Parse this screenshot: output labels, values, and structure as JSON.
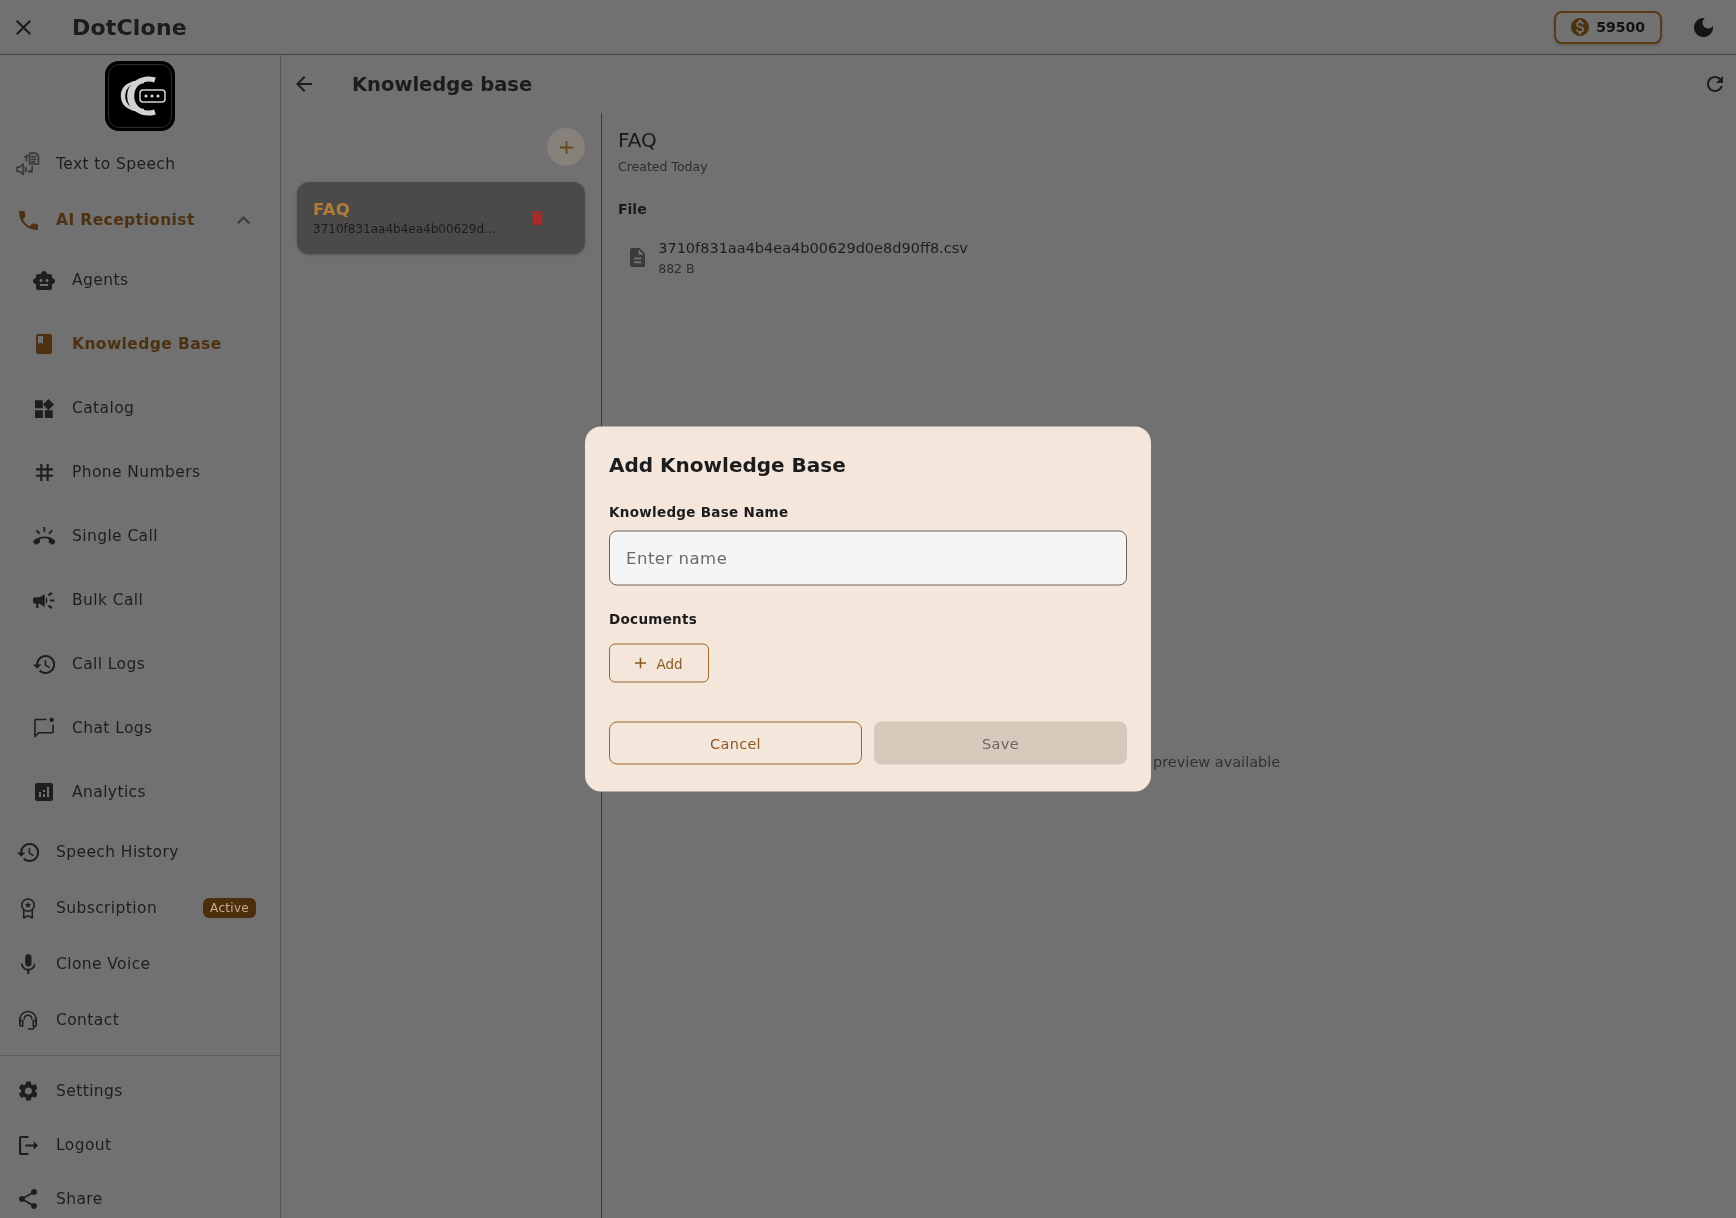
{
  "app_bar": {
    "title": "DotClone",
    "credits": "59500"
  },
  "sidebar": {
    "items": [
      {
        "kind": "link",
        "label": "Text to Speech",
        "selected": false
      },
      {
        "kind": "group",
        "label": "AI Receptionist",
        "selected": true,
        "expanded": true,
        "children": [
          {
            "label": "Agents",
            "selected": false
          },
          {
            "label": "Knowledge Base",
            "selected": true
          },
          {
            "label": "Catalog",
            "selected": false
          },
          {
            "label": "Phone Numbers",
            "selected": false
          },
          {
            "label": "Single Call",
            "selected": false
          },
          {
            "label": "Bulk Call",
            "selected": false
          },
          {
            "label": "Call Logs",
            "selected": false
          },
          {
            "label": "Chat Logs",
            "selected": false
          },
          {
            "label": "Analytics",
            "selected": false
          }
        ]
      },
      {
        "kind": "link",
        "label": "Speech History",
        "selected": false
      },
      {
        "kind": "link",
        "label": "Subscription",
        "selected": false,
        "badge": "Active"
      },
      {
        "kind": "link",
        "label": "Clone Voice",
        "selected": false
      },
      {
        "kind": "link",
        "label": "Contact",
        "selected": false
      }
    ],
    "footer_items": [
      {
        "label": "Settings"
      },
      {
        "label": "Logout"
      },
      {
        "label": "Share"
      }
    ]
  },
  "page": {
    "title": "Knowledge base"
  },
  "knowledge_bases": [
    {
      "name": "FAQ",
      "file_id": "3710f831aa4b4ea4b00629d…",
      "selected": true
    }
  ],
  "detail": {
    "title": "FAQ",
    "created": "Created Today",
    "files_heading": "File",
    "files": [
      {
        "name": "3710f831aa4b4ea4b00629d0e8d90ff8.csv",
        "size": "882 B"
      }
    ],
    "preview_note": "preview available"
  },
  "dialog": {
    "title": "Add Knowledge Base",
    "name_label": "Knowledge Base Name",
    "name_field": {
      "placeholder": "Enter name"
    },
    "documents_label": "Documents",
    "add_button": "Add",
    "buttons": [
      {
        "kind": "secondary",
        "label": "Cancel",
        "disabled": false
      },
      {
        "kind": "primary",
        "label": "Save",
        "disabled": true
      }
    ]
  }
}
